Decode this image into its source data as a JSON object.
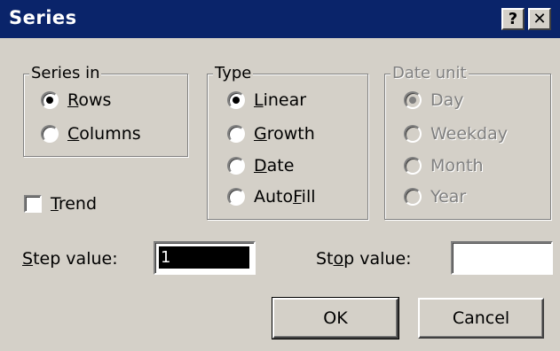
{
  "window": {
    "title": "Series",
    "help_label": "?",
    "close_label": "✕"
  },
  "series_in": {
    "legend": "Series in",
    "options": [
      {
        "pre": "",
        "accel": "R",
        "post": "ows",
        "checked": true
      },
      {
        "pre": "",
        "accel": "C",
        "post": "olumns",
        "checked": false
      }
    ]
  },
  "type": {
    "legend": "Type",
    "options": [
      {
        "pre": "",
        "accel": "L",
        "post": "inear",
        "checked": true
      },
      {
        "pre": "",
        "accel": "G",
        "post": "rowth",
        "checked": false
      },
      {
        "pre": "",
        "accel": "D",
        "post": "ate",
        "checked": false
      },
      {
        "pre": "Auto",
        "accel": "F",
        "post": "ill",
        "checked": false
      }
    ]
  },
  "date_unit": {
    "legend": "Date unit",
    "options": [
      "Day",
      "Weekday",
      "Month",
      "Year"
    ],
    "selected": "Day",
    "enabled": false
  },
  "trend": {
    "pre": "",
    "accel": "T",
    "post": "rend",
    "checked": false
  },
  "step_value": {
    "pre": "",
    "accel": "S",
    "post": "tep value:",
    "value": "1"
  },
  "stop_value": {
    "pre": "St",
    "accel": "o",
    "post": "p value:",
    "value": ""
  },
  "buttons": {
    "ok": "OK",
    "cancel": "Cancel"
  }
}
